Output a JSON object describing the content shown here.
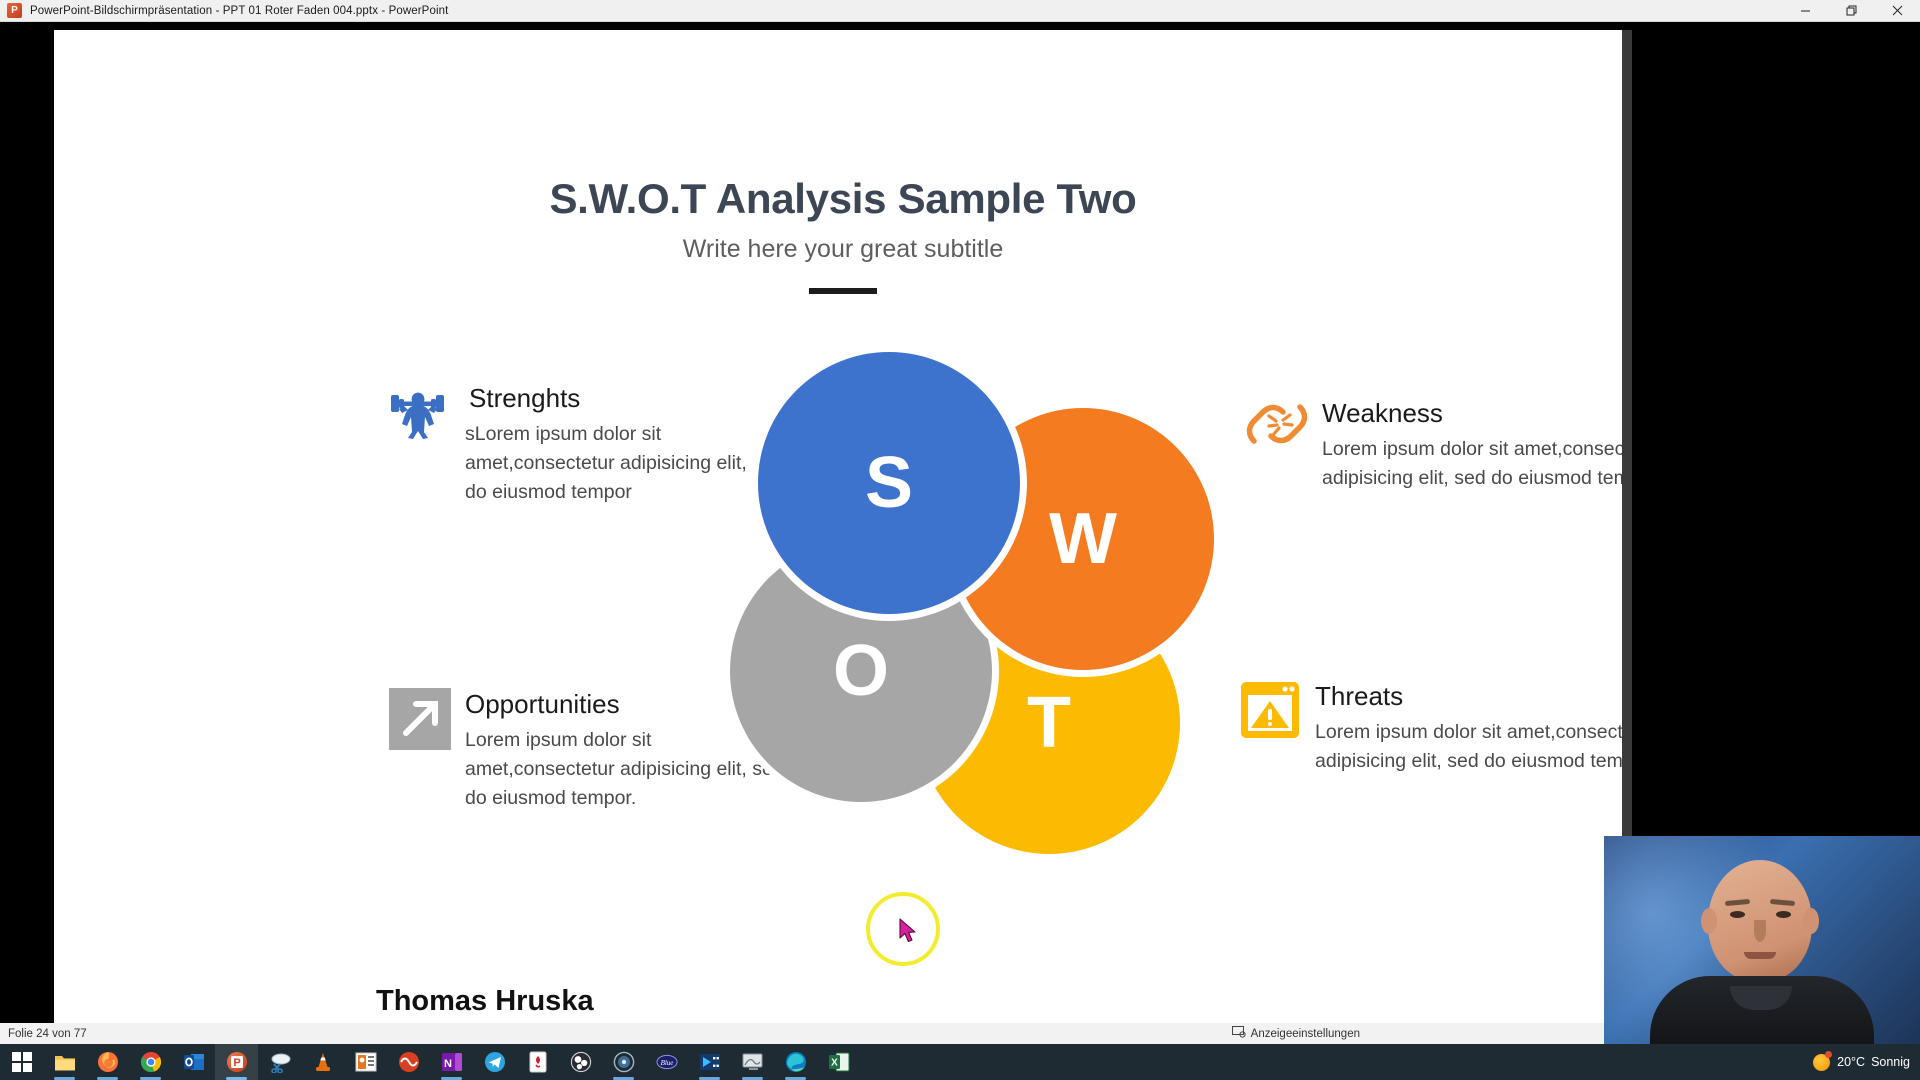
{
  "window": {
    "app_icon": "powerpoint-icon",
    "title": "PowerPoint-Bildschirmpräsentation  -  PPT 01 Roter Faden 004.pptx - PowerPoint",
    "minimize_label": "minimize-icon",
    "restore_label": "restore-icon",
    "close_label": "close-icon"
  },
  "slide": {
    "title": "S.W.O.T Analysis Sample Two",
    "subtitle": "Write here your great subtitle",
    "presenter": "Thomas Hruska",
    "blocks": [
      {
        "key": "strengths",
        "heading": "Strenghts",
        "body": "sLorem ipsum dolor sit amet,consectetur adipisicing elit, sed do eiusmod tempor",
        "icon": "weightlifter-icon",
        "color": "#3d72cd"
      },
      {
        "key": "weakness",
        "heading": "Weakness",
        "body": "Lorem ipsum dolor sit amet,consectetur adipisicing elit, sed do eiusmod tempor",
        "icon": "broken-chain-icon",
        "color": "#f47b20"
      },
      {
        "key": "opportunities",
        "heading": "Opportunities",
        "body": "Lorem ipsum dolor sit amet,consectetur adipisicing elit, sed do eiusmod tempor.",
        "icon": "arrow-up-right-icon",
        "color": "#a6a6a6"
      },
      {
        "key": "threats",
        "heading": "Threats",
        "body": "Lorem ipsum dolor sit amet,consectetur adipisicing elit, sed do eiusmod tempor",
        "icon": "warning-window-icon",
        "color": "#fcba00"
      }
    ],
    "circles": [
      {
        "letter": "S",
        "color": "#3d72cd",
        "name": "strengths"
      },
      {
        "letter": "W",
        "color": "#f47b20",
        "name": "weakness"
      },
      {
        "letter": "O",
        "color": "#a6a6a6",
        "name": "opportunities"
      },
      {
        "letter": "T",
        "color": "#fcba00",
        "name": "threats"
      }
    ],
    "laser_ring_color": "#f2ec2f",
    "cursor_color": "#d4219b"
  },
  "statusbar": {
    "slide_counter": "Folie 24 von 77",
    "display_settings": "Anzeigeeinstellungen",
    "display_settings_icon": "display-settings-icon"
  },
  "taskbar": {
    "items": [
      {
        "name": "start-button",
        "icon": "windows-logo-icon",
        "running": false,
        "active": false
      },
      {
        "name": "file-explorer-button",
        "icon": "folder-icon",
        "running": true,
        "active": false
      },
      {
        "name": "firefox-button",
        "icon": "firefox-icon",
        "running": true,
        "active": false
      },
      {
        "name": "chrome-button",
        "icon": "chrome-icon",
        "running": true,
        "active": false
      },
      {
        "name": "outlook-button",
        "icon": "outlook-icon",
        "running": false,
        "active": false
      },
      {
        "name": "powerpoint-button",
        "icon": "powerpoint-icon",
        "running": true,
        "active": true
      },
      {
        "name": "snipping-tool-button",
        "icon": "snipping-tool-icon",
        "running": false,
        "active": false
      },
      {
        "name": "vlc-button",
        "icon": "vlc-cone-icon",
        "running": false,
        "active": false
      },
      {
        "name": "photos-button",
        "icon": "photos-icon",
        "running": false,
        "active": false
      },
      {
        "name": "audacity-button",
        "icon": "audacity-icon",
        "running": false,
        "active": false
      },
      {
        "name": "onenote-button",
        "icon": "onenote-icon",
        "running": true,
        "active": false
      },
      {
        "name": "telegram-button",
        "icon": "telegram-icon",
        "running": false,
        "active": false
      },
      {
        "name": "pdf-reader-button",
        "icon": "pdf-reader-icon",
        "running": false,
        "active": false
      },
      {
        "name": "obs-button",
        "icon": "obs-studio-icon",
        "running": false,
        "active": false
      },
      {
        "name": "disc-button",
        "icon": "disc-icon",
        "running": true,
        "active": false
      },
      {
        "name": "blue-yeti-button",
        "icon": "blue-microphone-icon",
        "running": false,
        "active": false
      },
      {
        "name": "video-editor-button",
        "icon": "video-editor-icon",
        "running": true,
        "active": false
      },
      {
        "name": "display-tool-button",
        "icon": "monitor-icon",
        "running": true,
        "active": false
      },
      {
        "name": "edge-button",
        "icon": "edge-icon",
        "running": true,
        "active": false
      },
      {
        "name": "excel-button",
        "icon": "excel-icon",
        "running": false,
        "active": false
      }
    ],
    "weather": {
      "temperature": "20°C",
      "condition": "Sonnig",
      "icon": "sun-icon"
    }
  },
  "webcam": {
    "name": "presenter-webcam-overlay"
  }
}
